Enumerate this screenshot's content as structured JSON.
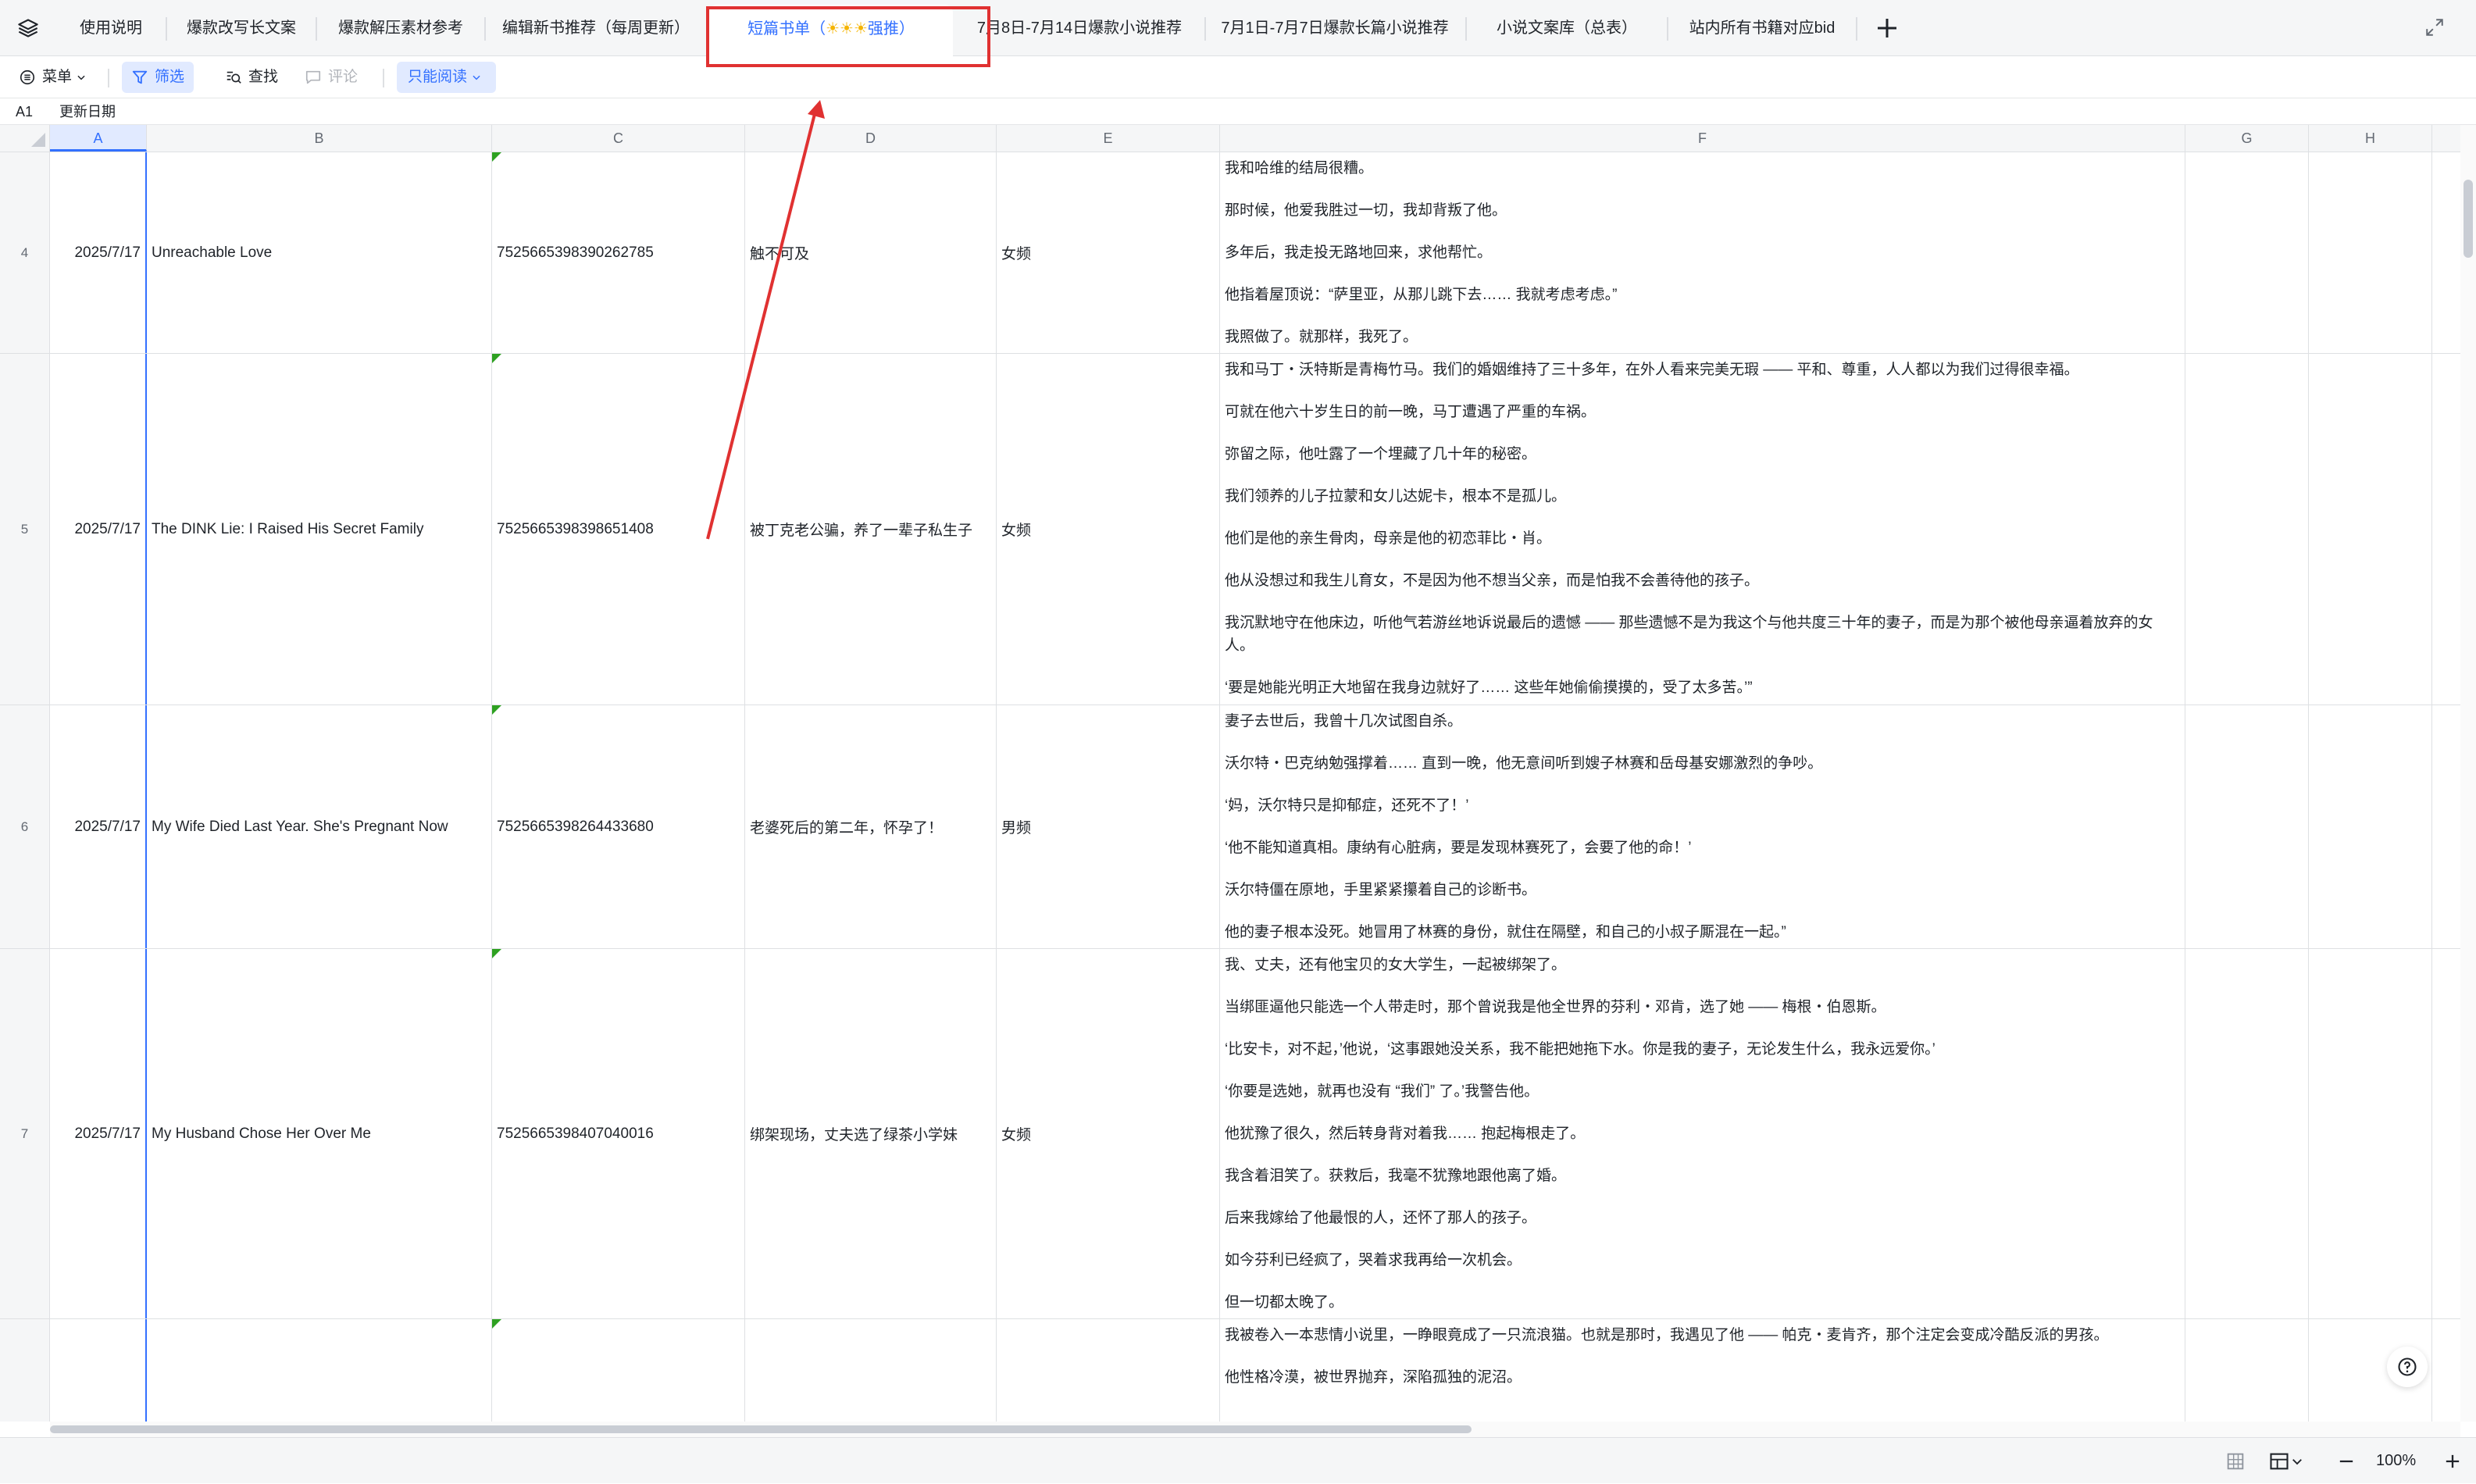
{
  "tabs": [
    {
      "label": "使用说明"
    },
    {
      "label": "爆款改写长文案"
    },
    {
      "label": "爆款解压素材参考"
    },
    {
      "label": "编辑新书推荐（每周更新）"
    },
    {
      "label_pre": "短篇书单（",
      "label_icons": "☀☀☀",
      "label_post": "强推）"
    },
    {
      "label": "7月8日-7月14日爆款小说推荐"
    },
    {
      "label": "7月1日-7月7日爆款长篇小说推荐"
    },
    {
      "label": "小说文案库（总表）"
    },
    {
      "label": "站内所有书籍对应bid"
    }
  ],
  "toolbar": {
    "menu_label": "菜单",
    "filter_label": "筛选",
    "find_label": "查找",
    "comment_label": "评论",
    "readonly_label": "只能阅读"
  },
  "formula": {
    "cell_ref": "A1",
    "value": "更新日期"
  },
  "columns": [
    "A",
    "B",
    "C",
    "D",
    "E",
    "F",
    "G",
    "H"
  ],
  "rows": [
    {
      "num": "4",
      "date": "2025/7/17",
      "title": "Unreachable Love",
      "bid": "7525665398390262785",
      "cn_title": "触不可及",
      "channel": "女频",
      "summary": [
        "我和哈维的结局很糟。",
        "那时候，他爱我胜过一切，我却背叛了他。",
        "多年后，我走投无路地回来，求他帮忙。",
        "他指着屋顶说：“萨里亚，从那儿跳下去…… 我就考虑考虑。”",
        "我照做了。就那样，我死了。"
      ]
    },
    {
      "num": "5",
      "date": "2025/7/17",
      "title": "The DINK Lie: I Raised His Secret Family",
      "bid": "7525665398398651408",
      "cn_title": "被丁克老公骗，养了一辈子私生子",
      "channel": "女频",
      "summary": [
        "我和马丁・沃特斯是青梅竹马。我们的婚姻维持了三十多年，在外人看来完美无瑕 —— 平和、尊重，人人都以为我们过得很幸福。",
        "可就在他六十岁生日的前一晚，马丁遭遇了严重的车祸。",
        "弥留之际，他吐露了一个埋藏了几十年的秘密。",
        "我们领养的儿子拉蒙和女儿达妮卡，根本不是孤儿。",
        "他们是他的亲生骨肉，母亲是他的初恋菲比・肖。",
        "他从没想过和我生儿育女，不是因为他不想当父亲，而是怕我不会善待他的孩子。",
        "我沉默地守在他床边，听他气若游丝地诉说最后的遗憾 —— 那些遗憾不是为我这个与他共度三十年的妻子，而是为那个被他母亲逼着放弃的女人。",
        "‘要是她能光明正大地留在我身边就好了…… 这些年她偷偷摸摸的，受了太多苦。’”"
      ]
    },
    {
      "num": "6",
      "date": "2025/7/17",
      "title": "My Wife Died Last Year. She's Pregnant Now",
      "bid": "7525665398264433680",
      "cn_title": "老婆死后的第二年，怀孕了！",
      "channel": "男频",
      "summary": [
        "妻子去世后，我曾十几次试图自杀。",
        "沃尔特・巴克纳勉强撑着…… 直到一晚，他无意间听到嫂子林赛和岳母基安娜激烈的争吵。",
        "‘妈，沃尔特只是抑郁症，还死不了！’",
        "‘他不能知道真相。康纳有心脏病，要是发现林赛死了，会要了他的命！’",
        "沃尔特僵在原地，手里紧紧攥着自己的诊断书。",
        "他的妻子根本没死。她冒用了林赛的身份，就住在隔壁，和自己的小叔子厮混在一起。”"
      ]
    },
    {
      "num": "7",
      "date": "2025/7/17",
      "title": "My Husband Chose Her Over Me",
      "bid": "7525665398407040016",
      "cn_title": "绑架现场，丈夫选了绿茶小学妹",
      "channel": "女频",
      "summary": [
        "我、丈夫，还有他宝贝的女大学生，一起被绑架了。",
        "当绑匪逼他只能选一个人带走时，那个曾说我是他全世界的芬利・邓肯，选了她 —— 梅根・伯恩斯。",
        "‘比安卡，对不起，’他说，‘这事跟她没关系，我不能把她拖下水。你是我的妻子，无论发生什么，我永远爱你。’",
        "‘你要是选她，就再也没有 “我们” 了。’我警告他。",
        "他犹豫了很久，然后转身背对着我…… 抱起梅根走了。",
        "我含着泪笑了。获救后，我毫不犹豫地跟他离了婚。",
        "后来我嫁给了他最恨的人，还怀了那人的孩子。",
        "如今芬利已经疯了，哭着求我再给一次机会。",
        "但一切都太晚了。"
      ]
    },
    {
      "num": "",
      "date": "",
      "title": "",
      "bid": "",
      "cn_title": "",
      "channel": "",
      "summary": [
        "我被卷入一本悲情小说里，一睁眼竟成了一只流浪猫。也就是那时，我遇见了他 —— 帕克・麦肯齐，那个注定会变成冷酷反派的男孩。",
        "他性格冷漠，被世界抛弃，深陷孤独的泥沼。"
      ]
    }
  ],
  "footer": {
    "zoom": "100%"
  },
  "colors": {
    "accent": "#3370ff",
    "annotation_red": "#e03131",
    "flag_green": "#2ea121"
  }
}
